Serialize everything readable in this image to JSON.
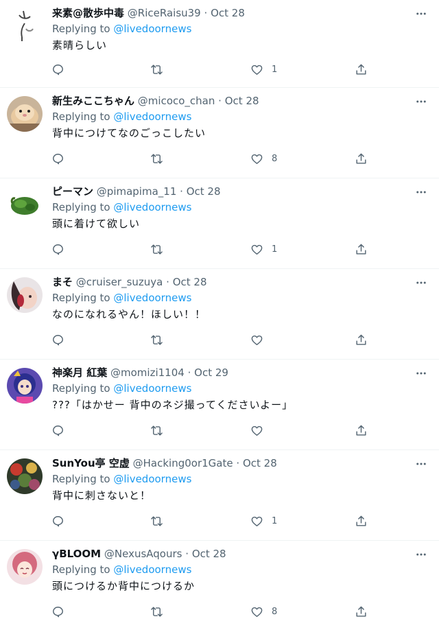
{
  "tweets": [
    {
      "name": "来素@散歩中毒",
      "handle": "@RiceRaisu39",
      "date": "Oct 28",
      "reply_prefix": "Replying to",
      "mention": "@livedoornews",
      "text": "素晴らしい",
      "likes": "1"
    },
    {
      "name": "新生みここちゃん",
      "handle": "@micoco_chan",
      "date": "Oct 28",
      "reply_prefix": "Replying to",
      "mention": "@livedoornews",
      "text": "背中につけてなのごっこしたい",
      "likes": "8"
    },
    {
      "name": "ピーマン",
      "handle": "@pimapima_11",
      "date": "Oct 28",
      "reply_prefix": "Replying to",
      "mention": "@livedoornews",
      "text": "頭に着けて欲しい",
      "likes": "1"
    },
    {
      "name": "まそ",
      "handle": "@cruiser_suzuya",
      "date": "Oct 28",
      "reply_prefix": "Replying to",
      "mention": "@livedoornews",
      "text": "なのになれるやん！ほしい！！",
      "likes": ""
    },
    {
      "name": "神楽月 紅葉",
      "handle": "@momizi1104",
      "date": "Oct 29",
      "reply_prefix": "Replying to",
      "mention": "@livedoornews",
      "text": "???「はかせー 背中のネジ撮ってくださいよー」",
      "likes": ""
    },
    {
      "name": "SunYou亭 空虚",
      "handle": "@Hacking0or1Gate",
      "date": "Oct 28",
      "reply_prefix": "Replying to",
      "mention": "@livedoornews",
      "text": "背中に刺さないと！",
      "likes": "1"
    },
    {
      "name": "γBLOOM",
      "handle": "@NexusAqours",
      "date": "Oct 28",
      "reply_prefix": "Replying to",
      "mention": "@livedoornews",
      "text": "頭につけるか背中につけるか",
      "likes": "8"
    }
  ],
  "separator": "·",
  "icons": {
    "reply": "reply-icon",
    "retweet": "retweet-icon",
    "like": "heart-icon",
    "share": "share-icon",
    "more": "more-icon"
  },
  "colors": {
    "text_primary": "#0f1419",
    "text_secondary": "#536471",
    "link": "#1d9bf0",
    "divider": "#eff3f4"
  }
}
